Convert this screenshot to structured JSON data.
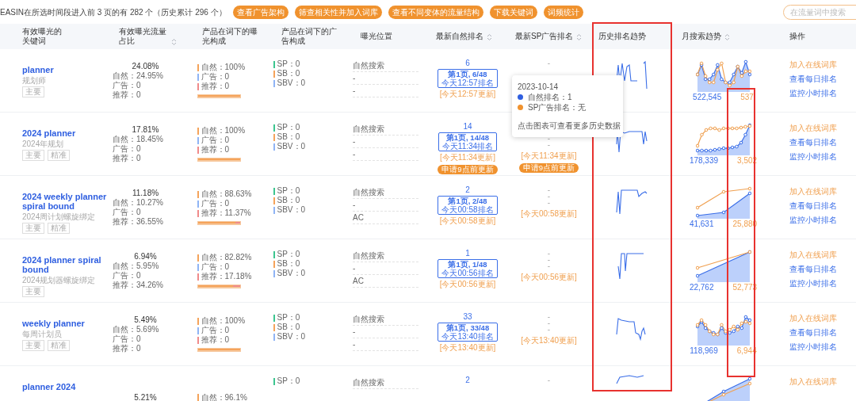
{
  "top_bar": {
    "summary": "EASIN在所选时间段进入前 3 页的有 282 个（历史累计 296 个）",
    "buttons": [
      "查看广告架构",
      "筛查相关性并加入词库",
      "查看不同变体的流量结构",
      "下载关键词",
      "词频统计"
    ],
    "search": {
      "placeholder": "在流量词中搜索"
    }
  },
  "table": {
    "columns": [
      {
        "label": "有效曝光的关键词",
        "sortable": false
      },
      {
        "label": "有效曝光流量占比",
        "sortable": true
      },
      {
        "label": "产品在词下的曝光构成",
        "sortable": false
      },
      {
        "label": "产品在词下的广告构成",
        "sortable": false
      },
      {
        "label": "曝光位置",
        "sortable": false
      },
      {
        "label": "最新自然排名",
        "sortable": true
      },
      {
        "label": "最新SP广告排名",
        "sortable": true
      },
      {
        "label": "历史排名趋势",
        "sortable": false
      },
      {
        "label": "月搜索趋势",
        "sortable": true
      },
      {
        "label": "操作",
        "sortable": false
      }
    ],
    "rows": [
      {
        "keyword": "planner",
        "translation": "规划师",
        "tags": [
          "主要"
        ],
        "share": "24.08%",
        "share_parts": [
          "自然：24.95%",
          "广告：0",
          "推荐：0"
        ],
        "exposure": [
          {
            "label": "自然：100%",
            "color": "#f5a35a"
          },
          {
            "label": "广告：0",
            "color": "#8fb4f5"
          },
          {
            "label": "推荐：0",
            "color": "#f08a8a"
          }
        ],
        "exposure_bar": {
          "level": 1
        },
        "ads": [
          {
            "label": "SP：0",
            "color": "#3cc58f"
          },
          {
            "label": "SB：0",
            "color": "#f5a35a"
          },
          {
            "label": "SBV：0",
            "color": "#8fb4f5"
          }
        ],
        "positions": [
          "自然搜索",
          "-",
          "-"
        ],
        "rank": "6",
        "rank_box": [
          "第1页, 6/48",
          "今天12:57排名"
        ],
        "rank_update": "[今天12:57更新]",
        "sp_lines": [
          "-"
        ],
        "monthly": [
          "522,545",
          "537"
        ],
        "actions": [
          "加入在线词库",
          "查看每日排名",
          "监控小时排名"
        ]
      },
      {
        "keyword": "2024 planner",
        "translation": "2024年规划",
        "tags": [
          "主要",
          "精准"
        ],
        "share": "17.81%",
        "share_parts": [
          "自然：18.45%",
          "广告：0",
          "推荐：0"
        ],
        "exposure": [
          {
            "label": "自然：100%",
            "color": "#f5a35a"
          },
          {
            "label": "广告：0",
            "color": "#8fb4f5"
          },
          {
            "label": "推荐：0",
            "color": "#f08a8a"
          }
        ],
        "exposure_bar": {
          "level": 1
        },
        "ads": [
          {
            "label": "SP：0",
            "color": "#3cc58f"
          },
          {
            "label": "SB：0",
            "color": "#f5a35a"
          },
          {
            "label": "SBV：0",
            "color": "#8fb4f5"
          }
        ],
        "positions": [
          "自然搜索",
          "-",
          "-"
        ],
        "rank": "14",
        "rank_box": [
          "第1页, 14/48",
          "今天11:34排名"
        ],
        "rank_update": "[今天11:34更新]",
        "rank_badge": "申请9点前更新",
        "sp_lines": [
          "-",
          "-"
        ],
        "sp_update": "[今天11:34更新]",
        "sp_badge": "申请9点前更新",
        "monthly": [
          "178,339",
          "3,502"
        ],
        "actions": [
          "加入在线词库",
          "查看每日排名",
          "监控小时排名"
        ]
      },
      {
        "keyword": "2024 weekly planner spiral bound",
        "translation": "2024周计划螺旋绑定",
        "tags": [
          "主要",
          "精准"
        ],
        "share": "11.18%",
        "share_parts": [
          "自然：10.27%",
          "广告：0",
          "推荐：36.55%"
        ],
        "exposure": [
          {
            "label": "自然：88.63%",
            "color": "#f5a35a"
          },
          {
            "label": "广告：0",
            "color": "#8fb4f5"
          },
          {
            "label": "推荐：11.37%",
            "color": "#f08a8a"
          }
        ],
        "exposure_bar": {
          "level": 0.886
        },
        "ads": [
          {
            "label": "SP：0",
            "color": "#3cc58f"
          },
          {
            "label": "SB：0",
            "color": "#f5a35a"
          },
          {
            "label": "SBV：0",
            "color": "#8fb4f5"
          }
        ],
        "positions": [
          "自然搜索",
          "-",
          "AC"
        ],
        "rank": "2",
        "rank_box": [
          "第1页, 2/48",
          "今天00:58排名"
        ],
        "rank_update": "[今天00:58更新]",
        "sp_lines": [
          "-",
          "-",
          "-"
        ],
        "sp_update": "[今天00:58更新]",
        "monthly": [
          "41,631",
          "25,880"
        ],
        "actions": [
          "加入在线词库",
          "查看每日排名",
          "监控小时排名"
        ]
      },
      {
        "keyword": "2024 planner spiral bound",
        "translation": "2024规划器螺旋绑定",
        "tags": [
          "主要"
        ],
        "share": "6.94%",
        "share_parts": [
          "自然：5.95%",
          "广告：0",
          "推荐：34.26%"
        ],
        "exposure": [
          {
            "label": "自然：82.82%",
            "color": "#f5a35a"
          },
          {
            "label": "广告：0",
            "color": "#8fb4f5"
          },
          {
            "label": "推荐：17.18%",
            "color": "#f08a8a"
          }
        ],
        "exposure_bar": {
          "level": 0.828
        },
        "ads": [
          {
            "label": "SP：0",
            "color": "#3cc58f"
          },
          {
            "label": "SB：0",
            "color": "#f5a35a"
          },
          {
            "label": "SBV：0",
            "color": "#8fb4f5"
          }
        ],
        "positions": [
          "自然搜索",
          "-",
          "AC"
        ],
        "rank": "1",
        "rank_box": [
          "第1页, 1/48",
          "今天00:56排名"
        ],
        "rank_update": "[今天00:56更新]",
        "sp_lines": [
          "-",
          "-",
          "-"
        ],
        "sp_update": "[今天00:56更新]",
        "monthly": [
          "22,762",
          "52,773"
        ],
        "actions": [
          "加入在线词库",
          "查看每日排名",
          "监控小时排名"
        ]
      },
      {
        "keyword": "weekly planner",
        "translation": "每周计划员",
        "tags": [
          "主要",
          "精准"
        ],
        "share": "5.49%",
        "share_parts": [
          "自然：5.69%",
          "广告：0",
          "推荐：0"
        ],
        "exposure": [
          {
            "label": "自然：100%",
            "color": "#f5a35a"
          },
          {
            "label": "广告：0",
            "color": "#8fb4f5"
          },
          {
            "label": "推荐：0",
            "color": "#f08a8a"
          }
        ],
        "exposure_bar": {
          "level": 1
        },
        "ads": [
          {
            "label": "SP：0",
            "color": "#3cc58f"
          },
          {
            "label": "SB：0",
            "color": "#f5a35a"
          },
          {
            "label": "SBV：0",
            "color": "#8fb4f5"
          }
        ],
        "positions": [
          "自然搜索",
          "-",
          "-"
        ],
        "rank": "33",
        "rank_box": [
          "第1页, 33/48",
          "今天13:40排名"
        ],
        "rank_update": "[今天13:40更新]",
        "sp_lines": [
          "-",
          "-",
          "-"
        ],
        "sp_update": "[今天13:40更新]",
        "monthly": [
          "118,969",
          "6,944"
        ],
        "actions": [
          "加入在线词库",
          "查看每日排名",
          "监控小时排名"
        ]
      },
      {
        "keyword": "planner 2024",
        "share": "5.21%",
        "exposure": [
          {
            "label": "自然：96.1%",
            "color": "#f5a35a"
          }
        ],
        "ads": [
          {
            "label": "SP：0",
            "color": "#3cc58f"
          }
        ],
        "positions": [
          "自然搜索"
        ],
        "rank": "2",
        "sp_lines": [
          "-"
        ],
        "actions": [
          "加入在线词库"
        ]
      }
    ]
  },
  "tooltip": {
    "date": "2023-10-14",
    "items": [
      {
        "label": "自然排名：1",
        "color": "#2f5fe0"
      },
      {
        "label": "SP广告排名：无",
        "color": "#f0922e"
      }
    ],
    "note": "点击图表可查看更多历史数据"
  }
}
